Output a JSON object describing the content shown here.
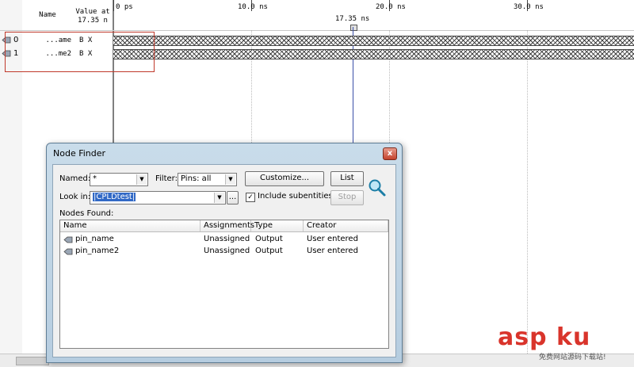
{
  "waveform": {
    "header": {
      "name": "Name",
      "value_line1": "Value at",
      "value_line2": "17.35 n"
    },
    "ruler": [
      "0 ps",
      "10.0 ns",
      "20.0 ns",
      "30.0 ns"
    ],
    "cursor_label": "17.35 ns",
    "signals": [
      {
        "index": "0",
        "name": "...ame",
        "value": "B X"
      },
      {
        "index": "1",
        "name": "...me2",
        "value": "B X"
      }
    ]
  },
  "dialog": {
    "title": "Node Finder",
    "close_glyph": "x",
    "named_label": "Named:",
    "named_value": "*",
    "filter_label": "Filter:",
    "filter_value": "Pins: all",
    "customize_label": "Customize...",
    "list_label": "List",
    "lookin_label": "Look in:",
    "lookin_value": "|CPLDtest|",
    "browse_label": "...",
    "include_subentities_label": "Include subentities",
    "include_subentities_checked": true,
    "stop_label": "Stop",
    "nodes_found_label": "Nodes Found:",
    "columns": [
      "Name",
      "Assignments",
      "Type",
      "Creator"
    ],
    "rows": [
      {
        "name": "pin_name",
        "assignments": "Unassigned",
        "type": "Output",
        "creator": "User entered"
      },
      {
        "name": "pin_name2",
        "assignments": "Unassigned",
        "type": "Output",
        "creator": "User entered"
      }
    ]
  },
  "watermark": {
    "main": "asp ku",
    "sub": "免费网站源码下载站!"
  },
  "colors": {
    "title_bar": "#b6cde0",
    "selection": "#3169c6",
    "marker_frame": "#c0392b",
    "watermark": "#d9342b"
  }
}
